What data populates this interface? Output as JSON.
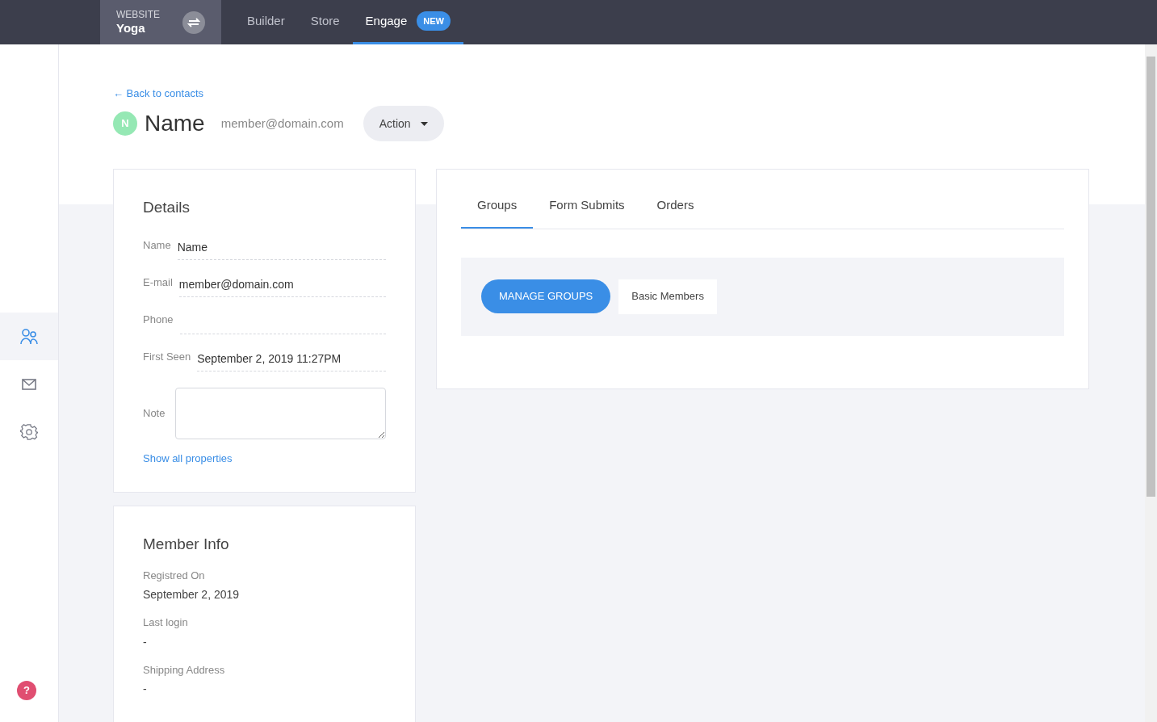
{
  "topbar": {
    "website_label": "WEBSITE",
    "website_name": "Yoga",
    "tabs": [
      {
        "label": "Builder",
        "selected": false
      },
      {
        "label": "Store",
        "selected": false
      },
      {
        "label": "Engage",
        "selected": true,
        "badge": "NEW"
      }
    ]
  },
  "sidebar": {
    "items": [
      {
        "kind": "contacts",
        "selected": true
      },
      {
        "kind": "mail",
        "selected": false
      },
      {
        "kind": "settings",
        "selected": false
      }
    ],
    "help": "?"
  },
  "header": {
    "back_link": "← Back to contacts",
    "avatar": "N",
    "name": "Name",
    "email": "member@domain.com",
    "action": "Action"
  },
  "details": {
    "title": "Details",
    "fields": [
      {
        "label": "Name",
        "value": "Name"
      },
      {
        "label": "E-mail",
        "value": "member@domain.com"
      },
      {
        "label": "Phone"
      },
      {
        "label": "First Seen",
        "value": "September 2, 2019 11:27PM"
      }
    ],
    "note_label": "Note",
    "show_all": "Show all properties"
  },
  "member_info": {
    "title": "Member Info",
    "items": [
      {
        "label": "Registred On",
        "value": "September 2, 2019"
      },
      {
        "label": "Last login",
        "value": "-"
      },
      {
        "label": "Shipping Address",
        "value": "-"
      }
    ]
  },
  "tabs": [
    {
      "label": "Groups",
      "selected": true
    },
    {
      "label": "Form Submits",
      "selected": false
    },
    {
      "label": "Orders",
      "selected": false
    }
  ],
  "groups": {
    "button": "MANAGE GROUPS",
    "items": [
      "Basic Members"
    ]
  }
}
